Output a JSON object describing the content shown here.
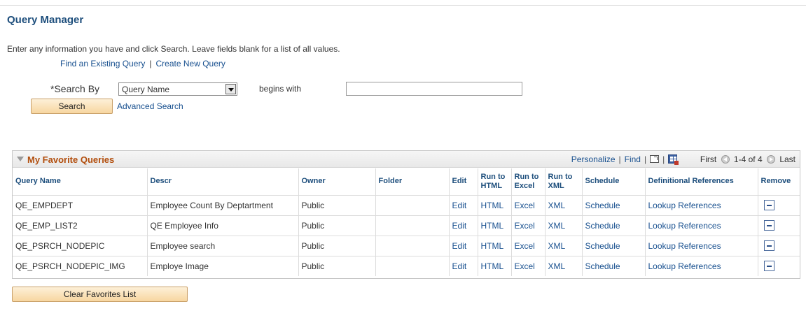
{
  "page": {
    "title": "Query Manager",
    "instructions": "Enter any information you have and click Search. Leave fields blank for a list of all values."
  },
  "tabs": {
    "find_existing": "Find an Existing Query",
    "separator": "|",
    "create_new": "Create New Query"
  },
  "search": {
    "search_by_label": "*Search By",
    "search_by_value": "Query Name",
    "operator_label": "begins with",
    "input_value": "",
    "search_button": "Search",
    "advanced_link": "Advanced Search"
  },
  "favorites": {
    "title": "My Favorite Queries",
    "nav": {
      "personalize": "Personalize",
      "find": "Find",
      "first": "First",
      "range": "1-4 of 4",
      "last": "Last"
    },
    "columns": {
      "query_name": "Query Name",
      "descr": "Descr",
      "owner": "Owner",
      "folder": "Folder",
      "edit": "Edit",
      "run_html": "Run to HTML",
      "run_excel": "Run to Excel",
      "run_xml": "Run to XML",
      "schedule": "Schedule",
      "def_refs": "Definitional References",
      "remove": "Remove"
    },
    "rows": [
      {
        "query_name": "QE_EMPDEPT",
        "descr": "Employee Count By Deptartment",
        "owner": "Public",
        "folder": "",
        "edit": "Edit",
        "html": "HTML",
        "excel": "Excel",
        "xml": "XML",
        "schedule": "Schedule",
        "refs": "Lookup References"
      },
      {
        "query_name": "QE_EMP_LIST2",
        "descr": "QE Employee Info",
        "owner": "Public",
        "folder": "",
        "edit": "Edit",
        "html": "HTML",
        "excel": "Excel",
        "xml": "XML",
        "schedule": "Schedule",
        "refs": "Lookup References"
      },
      {
        "query_name": "QE_PSRCH_NODEPIC",
        "descr": "Employee search",
        "owner": "Public",
        "folder": "",
        "edit": "Edit",
        "html": "HTML",
        "excel": "Excel",
        "xml": "XML",
        "schedule": "Schedule",
        "refs": "Lookup References"
      },
      {
        "query_name": "QE_PSRCH_NODEPIC_IMG",
        "descr": "Employe Image",
        "owner": "Public",
        "folder": "",
        "edit": "Edit",
        "html": "HTML",
        "excel": "Excel",
        "xml": "XML",
        "schedule": "Schedule",
        "refs": "Lookup References"
      }
    ],
    "clear_button": "Clear Favorites List"
  },
  "colors": {
    "title_blue": "#1d4e7c",
    "link_blue": "#18508f",
    "grid_title_orange": "#b24e0d",
    "button_fill": "#f7d6a0"
  },
  "icons": [
    "collapse-triangle-icon",
    "zoom-grid-icon",
    "download-excel-icon",
    "first-page-icon",
    "next-page-icon",
    "remove-icon",
    "dropdown-arrow-icon"
  ]
}
